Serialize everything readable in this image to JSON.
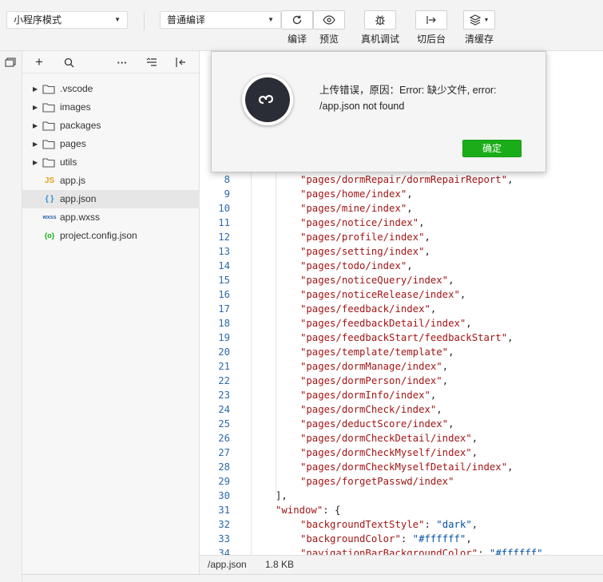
{
  "toolbar": {
    "mode_select": "小程序模式",
    "compile_select": "普通编译",
    "buttons": [
      {
        "label": "编译",
        "icon": "refresh-icon"
      },
      {
        "label": "预览",
        "icon": "eye-icon"
      },
      {
        "label": "真机调试",
        "icon": "bug-icon"
      },
      {
        "label": "切后台",
        "icon": "switch-background-icon"
      },
      {
        "label": "清缓存",
        "icon": "layers-icon"
      }
    ]
  },
  "explorer": {
    "items": [
      {
        "label": ".vscode",
        "type": "folder"
      },
      {
        "label": "images",
        "type": "folder"
      },
      {
        "label": "packages",
        "type": "folder"
      },
      {
        "label": "pages",
        "type": "folder"
      },
      {
        "label": "utils",
        "type": "folder"
      },
      {
        "label": "app.js",
        "type": "js",
        "badge": "JS"
      },
      {
        "label": "app.json",
        "type": "json",
        "badge": "{ }"
      },
      {
        "label": "app.wxss",
        "type": "wxss",
        "badge": "wxss"
      },
      {
        "label": "project.config.json",
        "type": "config",
        "badge": "{o}"
      }
    ],
    "selected": "app.json"
  },
  "editor": {
    "lines": [
      {
        "n": "8",
        "indent": 2,
        "text": "\"pages/dormRepair/dormRepairReport\","
      },
      {
        "n": "9",
        "indent": 2,
        "text": "\"pages/home/index\","
      },
      {
        "n": "10",
        "indent": 2,
        "text": "\"pages/mine/index\","
      },
      {
        "n": "11",
        "indent": 2,
        "text": "\"pages/notice/index\","
      },
      {
        "n": "12",
        "indent": 2,
        "text": "\"pages/profile/index\","
      },
      {
        "n": "13",
        "indent": 2,
        "text": "\"pages/setting/index\","
      },
      {
        "n": "14",
        "indent": 2,
        "text": "\"pages/todo/index\","
      },
      {
        "n": "15",
        "indent": 2,
        "text": "\"pages/noticeQuery/index\","
      },
      {
        "n": "16",
        "indent": 2,
        "text": "\"pages/noticeRelease/index\","
      },
      {
        "n": "17",
        "indent": 2,
        "text": "\"pages/feedback/index\","
      },
      {
        "n": "18",
        "indent": 2,
        "text": "\"pages/feedbackDetail/index\","
      },
      {
        "n": "19",
        "indent": 2,
        "text": "\"pages/feedbackStart/feedbackStart\","
      },
      {
        "n": "20",
        "indent": 2,
        "text": "\"pages/template/template\","
      },
      {
        "n": "21",
        "indent": 2,
        "text": "\"pages/dormManage/index\","
      },
      {
        "n": "22",
        "indent": 2,
        "text": "\"pages/dormPerson/index\","
      },
      {
        "n": "23",
        "indent": 2,
        "text": "\"pages/dormInfo/index\","
      },
      {
        "n": "24",
        "indent": 2,
        "text": "\"pages/dormCheck/index\","
      },
      {
        "n": "25",
        "indent": 2,
        "text": "\"pages/deductScore/index\","
      },
      {
        "n": "26",
        "indent": 2,
        "text": "\"pages/dormCheckDetail/index\","
      },
      {
        "n": "27",
        "indent": 2,
        "text": "\"pages/dormCheckMyself/index\","
      },
      {
        "n": "28",
        "indent": 2,
        "text": "\"pages/dormCheckMyselfDetail/index\","
      },
      {
        "n": "29",
        "indent": 2,
        "text": "\"pages/forgetPasswd/index\""
      },
      {
        "n": "30",
        "indent": 1,
        "text": "],"
      },
      {
        "n": "31",
        "indent": 1,
        "text": "\"window\": {"
      },
      {
        "n": "32",
        "indent": 2,
        "text": "\"backgroundTextStyle\": \"dark\","
      },
      {
        "n": "33",
        "indent": 2,
        "text": "\"backgroundColor\": \"#ffffff\","
      },
      {
        "n": "34",
        "indent": 2,
        "text": "\"navigationBarBackgroundColor\": \"#ffffff\","
      }
    ]
  },
  "statusbar": {
    "path": "/app.json",
    "size": "1.8 KB"
  },
  "dialog": {
    "message_line1": "上传错误，原因：Error: 缺少文件, error:",
    "message_line2": "/app.json not found",
    "ok_label": "确定"
  },
  "colors": {
    "ok_button": "#1aad19",
    "line_number": "#2b6aa8",
    "string": "#a31515",
    "value": "#0451a5"
  }
}
